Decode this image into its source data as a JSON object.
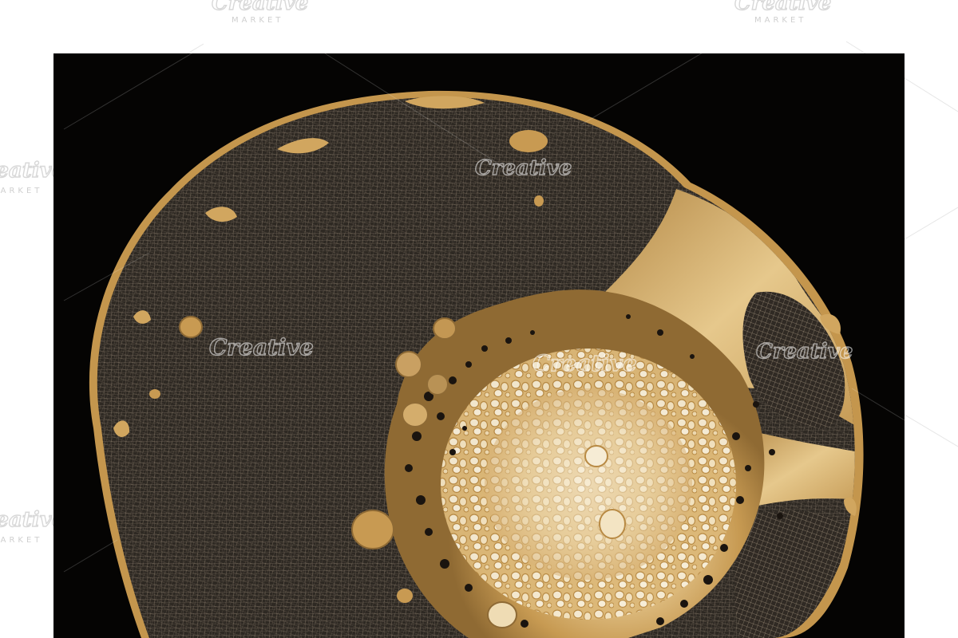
{
  "image": {
    "subject": "gold-toned micrograph of a plant stem cross-section on black background",
    "background_color": "#050403",
    "frame_color": "#ffffff",
    "tissue_colors": {
      "cell_mesh": "#8a7d6c",
      "cell_fill": "#2d2823",
      "gold": "#c89a52",
      "gold_light": "#e9d2a2",
      "pale_core": "#f3e6c8"
    }
  },
  "watermark": {
    "brand": "Creative",
    "tagline": "MARKET"
  }
}
